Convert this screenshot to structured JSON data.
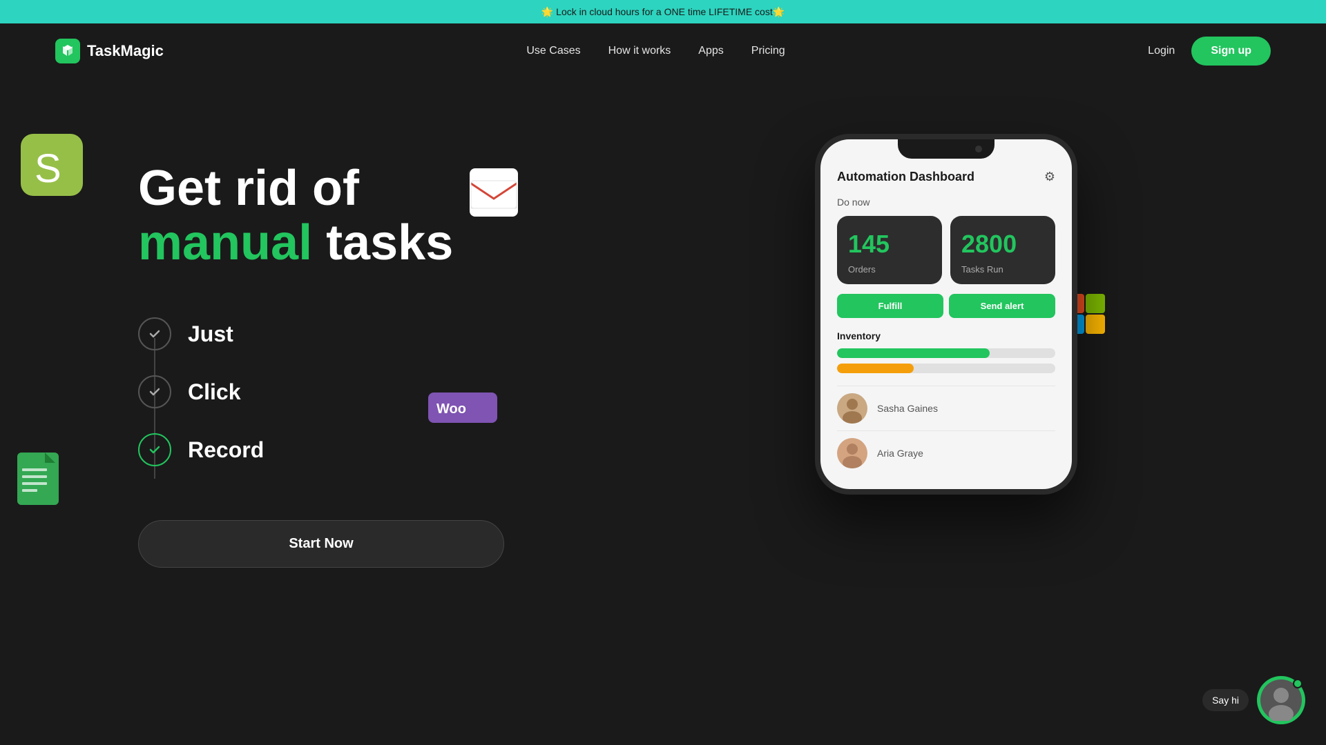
{
  "banner": {
    "text": "🌟 Lock in cloud hours for a ONE time LIFETIME cost🌟"
  },
  "nav": {
    "logo_text": "TaskMagic",
    "links": [
      {
        "label": "Use Cases",
        "href": "#"
      },
      {
        "label": "How it works",
        "href": "#"
      },
      {
        "label": "Apps",
        "href": "#"
      },
      {
        "label": "Pricing",
        "href": "#"
      }
    ],
    "login_label": "Login",
    "signup_label": "Sign up"
  },
  "hero": {
    "title_line1": "Get rid of",
    "title_line2_green": "manual",
    "title_line2_rest": " tasks",
    "steps": [
      {
        "label": "Just",
        "active": false
      },
      {
        "label": "Click",
        "active": false
      },
      {
        "label": "Record",
        "active": true
      }
    ],
    "start_btn": "Start Now"
  },
  "dashboard": {
    "title": "Automation Dashboard",
    "do_now_label": "Do now",
    "stats": [
      {
        "number": "145",
        "label": "Orders"
      },
      {
        "number": "2800",
        "label": "Tasks Run"
      }
    ],
    "buttons": [
      {
        "label": "Fulfill"
      },
      {
        "label": "Send alert"
      }
    ],
    "inventory_label": "Inventory",
    "progress_bars": [
      {
        "type": "green",
        "fill": 70
      },
      {
        "type": "orange",
        "fill": 35
      }
    ],
    "persons": [
      {
        "name": "Sasha Gaines",
        "emoji": "👩"
      },
      {
        "name": "Aria Graye",
        "emoji": "👩"
      }
    ]
  },
  "chat": {
    "label": "Say hi",
    "emoji": "👨"
  },
  "colors": {
    "green": "#22c55e",
    "banner_bg": "#2dd4bf",
    "dark": "#1a1a1a",
    "card_dark": "#2d2d2d"
  }
}
